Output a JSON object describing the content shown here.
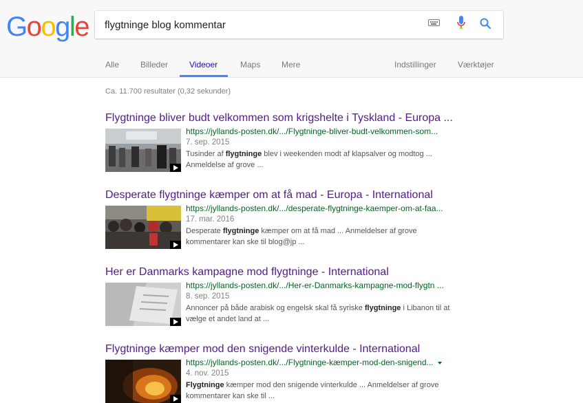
{
  "logo": {
    "letters": [
      "G",
      "o",
      "o",
      "g",
      "l",
      "e"
    ],
    "colors": [
      "#4285f4",
      "#ea4335",
      "#fbbc05",
      "#4285f4",
      "#34a853",
      "#ea4335"
    ]
  },
  "search": {
    "query": "flygtninge blog kommentar"
  },
  "tabs": {
    "alle": "Alle",
    "billeder": "Billeder",
    "videoer": "Videoer",
    "maps": "Maps",
    "mere": "Mere",
    "indstillinger": "Indstillinger",
    "vaerktojer": "Værktøjer"
  },
  "stats": "Ca. 11.700 resultater (0,32 sekunder)",
  "results": [
    {
      "title": "Flygtninge bliver budt velkommen som krigshelte i Tyskland - Europa ...",
      "url": "https://jyllands-posten.dk/.../Flygtninge-bliver-budt-velkommen-som...",
      "date": "7. sep. 2015",
      "snippet1a": "Tusinder af ",
      "snippet1b": "flygtninge",
      "snippet1c": " blev i weekenden modt af klapsalver og modtog ...",
      "snippet2": "Anmeldelse af grove ..."
    },
    {
      "title": "Desperate flygtninge kæmper om at få mad - Europa - International",
      "url": "https://jyllands-posten.dk/.../desperate-flygtninge-kaemper-om-at-faa...",
      "date": "17. mar. 2016",
      "snippet1a": "Desperate ",
      "snippet1b": "flygtninge",
      "snippet1c": " kæmper om at få mad ... Anmeldelser af grove",
      "snippet2": "kommentarer kan ske til blog@jp ..."
    },
    {
      "title": "Her er Danmarks kampagne mod flygtninge - International",
      "url": "https://jyllands-posten.dk/.../Her-er-Danmarks-kampagne-mod-flygtn ...",
      "date": "8. sep. 2015",
      "snippet1a": "Annoncer på både arabisk og engelsk skal få syriske ",
      "snippet1b": "flygtninge",
      "snippet1c": " i Libanon til at",
      "snippet2": "vælge et andet land at ..."
    },
    {
      "title": "Flygtninge kæmper mod den snigende vinterkulde - International",
      "url": "https://jyllands-posten.dk/.../Flygtninge-kæmper-mod-den-snigend...",
      "date": "4. nov. 2015",
      "snippet1a": "",
      "snippet1b": "Flygtninge",
      "snippet1c": " kæmper mod den snigende vinterkulde ... Anmeldelser af grove",
      "snippet2": "kommentarer kan ske til ..."
    }
  ]
}
